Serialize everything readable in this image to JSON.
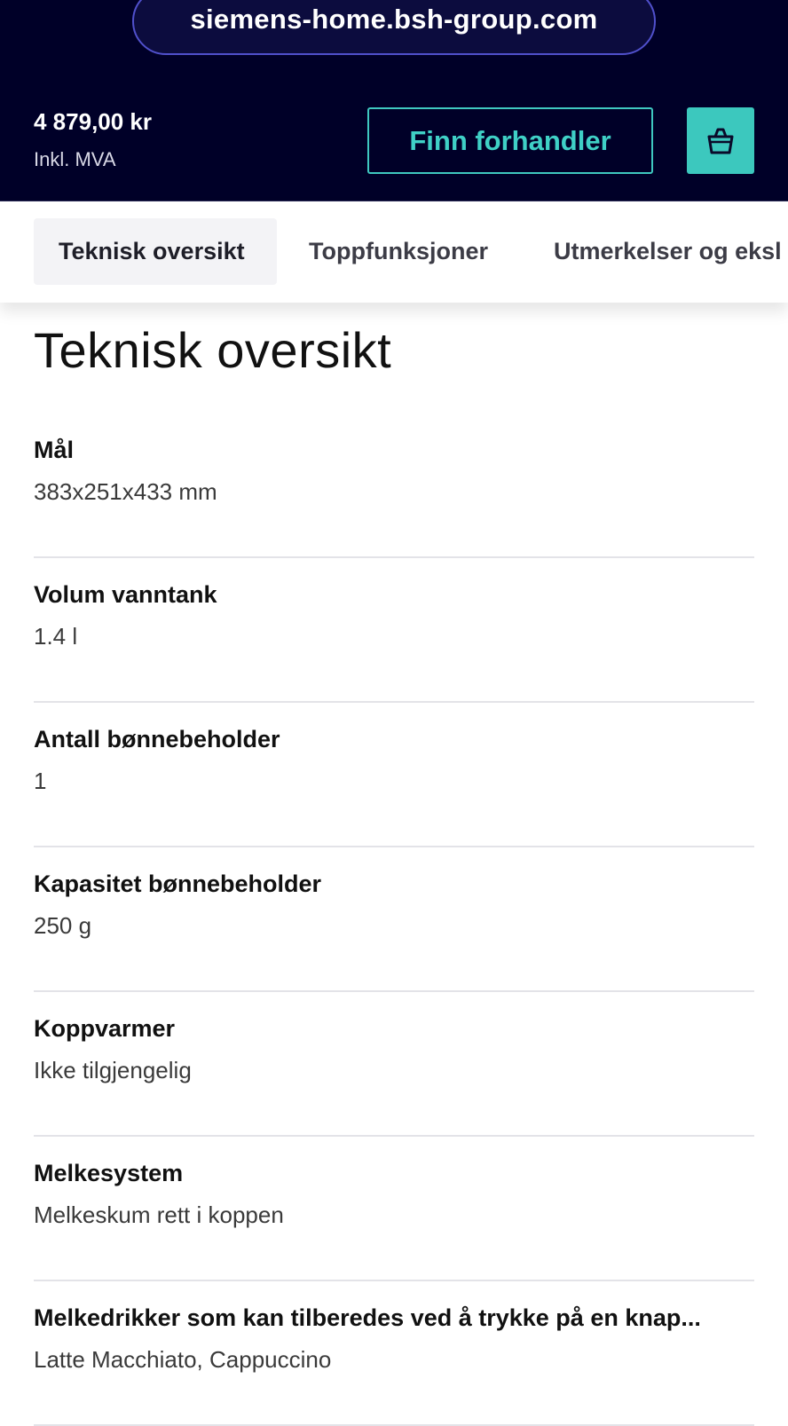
{
  "browser": {
    "url": "siemens-home.bsh-group.com"
  },
  "header": {
    "price": "4 879,00 kr",
    "vat_note": "Inkl. MVA",
    "dealer_button": "Finn forhandler",
    "cart_icon": "shopping-basket-icon"
  },
  "tabs": [
    {
      "label": "Teknisk oversikt",
      "active": true
    },
    {
      "label": "Toppfunksjoner",
      "active": false
    },
    {
      "label": "Utmerkelser og eksl",
      "active": false
    }
  ],
  "section": {
    "title": "Teknisk oversikt"
  },
  "specs": [
    {
      "label": "Mål",
      "value": "383x251x433 mm"
    },
    {
      "label": "Volum vanntank",
      "value": "1.4 l"
    },
    {
      "label": "Antall bønnebeholder",
      "value": "1"
    },
    {
      "label": "Kapasitet bønnebeholder",
      "value": "250 g"
    },
    {
      "label": "Koppvarmer",
      "value": "Ikke tilgjengelig"
    },
    {
      "label": "Melkesystem",
      "value": "Melkeskum rett i koppen"
    },
    {
      "label": "Melkedrikker som kan tilberedes ved å trykke på en knap...",
      "value": "Latte Macchiato, Cappuccino"
    }
  ],
  "colors": {
    "header_bg": "#000028",
    "accent": "#3cc8be",
    "active_tab_bg": "#f3f3f6"
  }
}
